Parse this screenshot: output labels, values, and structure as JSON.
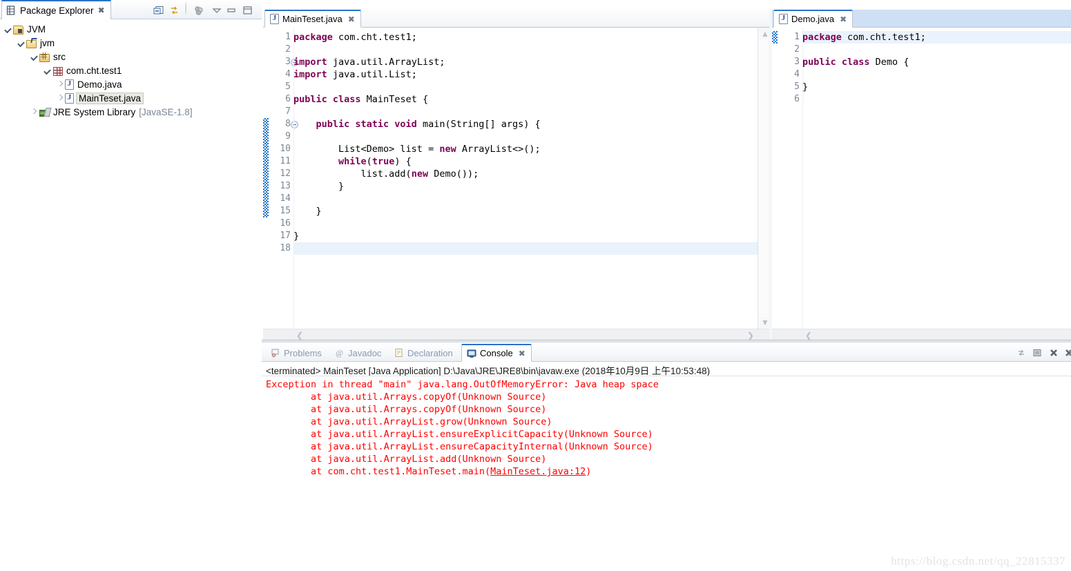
{
  "explorer": {
    "tab_label": "Package Explorer",
    "tab_close": "✖",
    "icons": {
      "view": "package-explorer-icon",
      "collapse_all": "collapse-all-icon",
      "link_editor": "link-with-editor-icon",
      "focus": "focus-on-active-task-icon",
      "view_menu": "view-menu-icon",
      "minimize": "minimize-icon",
      "maximize": "maximize-icon"
    },
    "tree": [
      {
        "label": "JVM",
        "indent": 0,
        "twisty": "down",
        "icon": "jvm-project-icon",
        "selected": false,
        "suffix": ""
      },
      {
        "label": "jvm",
        "indent": 1,
        "twisty": "down",
        "icon": "source-folder-icon",
        "selected": false,
        "suffix": ""
      },
      {
        "label": "src",
        "indent": 2,
        "twisty": "down",
        "icon": "source-root-icon",
        "selected": false,
        "suffix": ""
      },
      {
        "label": "com.cht.test1",
        "indent": 3,
        "twisty": "down",
        "icon": "package-icon",
        "selected": false,
        "suffix": ""
      },
      {
        "label": "Demo.java",
        "indent": 4,
        "twisty": "right",
        "icon": "java-file-icon",
        "selected": false,
        "suffix": ""
      },
      {
        "label": "MainTeset.java",
        "indent": 4,
        "twisty": "right",
        "icon": "java-file-icon",
        "selected": true,
        "suffix": ""
      },
      {
        "label": "JRE System Library",
        "indent": 2,
        "twisty": "right",
        "icon": "jre-library-icon",
        "selected": false,
        "suffix": "[JavaSE-1.8]"
      }
    ]
  },
  "editor_left": {
    "tab_label": "MainTeset.java",
    "tab_close": "✖",
    "changed_lines": {
      "from": 8,
      "to": 15
    },
    "current_line": 18,
    "fold_markers": [
      3,
      8
    ],
    "lines": [
      {
        "n": 1,
        "tokens": [
          {
            "t": "package",
            "k": true
          },
          {
            "t": " com.cht.test1;",
            "k": false
          }
        ]
      },
      {
        "n": 2,
        "tokens": [
          {
            "t": "",
            "k": false
          }
        ]
      },
      {
        "n": 3,
        "tokens": [
          {
            "t": "import",
            "k": true
          },
          {
            "t": " java.util.ArrayList;",
            "k": false
          }
        ]
      },
      {
        "n": 4,
        "tokens": [
          {
            "t": "import",
            "k": true
          },
          {
            "t": " java.util.List;",
            "k": false
          }
        ]
      },
      {
        "n": 5,
        "tokens": [
          {
            "t": "",
            "k": false
          }
        ]
      },
      {
        "n": 6,
        "tokens": [
          {
            "t": "public class",
            "k": true
          },
          {
            "t": " MainTeset {",
            "k": false
          }
        ]
      },
      {
        "n": 7,
        "tokens": [
          {
            "t": "",
            "k": false
          }
        ]
      },
      {
        "n": 8,
        "tokens": [
          {
            "t": "    public static void",
            "k": true
          },
          {
            "t": " main(String[] args) {",
            "k": false
          }
        ]
      },
      {
        "n": 9,
        "tokens": [
          {
            "t": "",
            "k": false
          }
        ]
      },
      {
        "n": 10,
        "tokens": [
          {
            "t": "        List<Demo> list = ",
            "k": false
          },
          {
            "t": "new",
            "k": true
          },
          {
            "t": " ArrayList<>();",
            "k": false
          }
        ]
      },
      {
        "n": 11,
        "tokens": [
          {
            "t": "        while",
            "k": true
          },
          {
            "t": "(",
            "k": false
          },
          {
            "t": "true",
            "k": true
          },
          {
            "t": ") {",
            "k": false
          }
        ]
      },
      {
        "n": 12,
        "tokens": [
          {
            "t": "            list.add(",
            "k": false
          },
          {
            "t": "new",
            "k": true
          },
          {
            "t": " Demo());",
            "k": false
          }
        ]
      },
      {
        "n": 13,
        "tokens": [
          {
            "t": "        }",
            "k": false
          }
        ]
      },
      {
        "n": 14,
        "tokens": [
          {
            "t": "",
            "k": false
          }
        ]
      },
      {
        "n": 15,
        "tokens": [
          {
            "t": "    }",
            "k": false
          }
        ]
      },
      {
        "n": 16,
        "tokens": [
          {
            "t": "",
            "k": false
          }
        ]
      },
      {
        "n": 17,
        "tokens": [
          {
            "t": "}",
            "k": false
          }
        ]
      },
      {
        "n": 18,
        "tokens": [
          {
            "t": "",
            "k": false
          }
        ]
      }
    ]
  },
  "editor_right": {
    "tab_label": "Demo.java",
    "tab_close": "✖",
    "changed_lines": {
      "from": 1,
      "to": 1
    },
    "current_line": 1,
    "fold_markers": [],
    "lines": [
      {
        "n": 1,
        "tokens": [
          {
            "t": "package",
            "k": true
          },
          {
            "t": " com.cht.test1;",
            "k": false
          }
        ]
      },
      {
        "n": 2,
        "tokens": [
          {
            "t": "",
            "k": false
          }
        ]
      },
      {
        "n": 3,
        "tokens": [
          {
            "t": "public class",
            "k": true
          },
          {
            "t": " Demo {",
            "k": false
          }
        ]
      },
      {
        "n": 4,
        "tokens": [
          {
            "t": "",
            "k": false
          }
        ]
      },
      {
        "n": 5,
        "tokens": [
          {
            "t": "}",
            "k": false
          }
        ]
      },
      {
        "n": 6,
        "tokens": [
          {
            "t": "",
            "k": false
          }
        ]
      }
    ]
  },
  "console": {
    "tabs": [
      {
        "label": "Problems",
        "active": false,
        "icon": "problems-icon"
      },
      {
        "label": "Javadoc",
        "active": false,
        "icon": "javadoc-icon"
      },
      {
        "label": "Declaration",
        "active": false,
        "icon": "declaration-icon"
      },
      {
        "label": "Console",
        "active": true,
        "icon": "console-icon"
      }
    ],
    "tab_close": "✖",
    "header": "<terminated> MainTeset [Java Application] D:\\Java\\JRE\\JRE8\\bin\\javaw.exe (2018年10月9日 上午10:53:48)",
    "toolbar": {
      "pin": "pin-console-icon",
      "stop": "terminate-icon",
      "remove": "remove-launch-icon",
      "remove_all": "remove-all-terminated-icon"
    },
    "output": [
      {
        "text": "Exception in thread \"main\" java.lang.OutOfMemoryError: Java heap space",
        "link": null
      },
      {
        "text": "        at java.util.Arrays.copyOf(Unknown Source)",
        "link": null
      },
      {
        "text": "        at java.util.Arrays.copyOf(Unknown Source)",
        "link": null
      },
      {
        "text": "        at java.util.ArrayList.grow(Unknown Source)",
        "link": null
      },
      {
        "text": "        at java.util.ArrayList.ensureExplicitCapacity(Unknown Source)",
        "link": null
      },
      {
        "text": "        at java.util.ArrayList.ensureCapacityInternal(Unknown Source)",
        "link": null
      },
      {
        "text": "        at java.util.ArrayList.add(Unknown Source)",
        "link": null
      },
      {
        "text": "        at com.cht.test1.MainTeset.main(",
        "link": "MainTeset.java:12",
        "tail": ")"
      }
    ]
  },
  "watermark": "https://blog.csdn.net/qq_22815337",
  "colors": {
    "keyword": "#7f0055",
    "error": "#ff0000",
    "line_number": "#7b8694",
    "current_line": "#eaf2fb",
    "change_bar": "#1a74cd",
    "tab_accent": "#2a72c8",
    "selection": "#e9e9e5"
  }
}
